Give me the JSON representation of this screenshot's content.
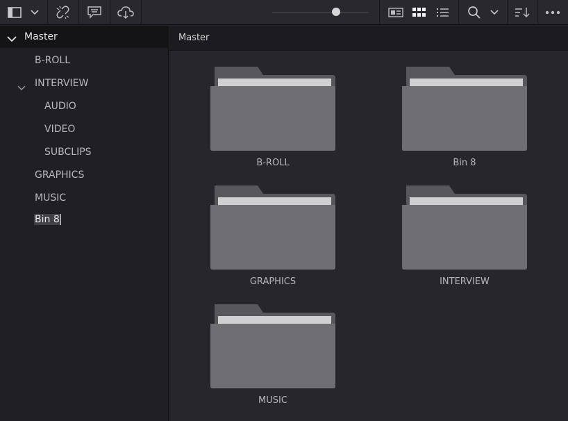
{
  "toolbar": {
    "icons": [
      "sidebar-toggle-icon",
      "chevron-down-icon",
      "unlink-icon",
      "subtitle-icon",
      "cloud-icon",
      "zoom-slider",
      "metadata-view-icon",
      "thumbnail-view-icon",
      "list-view-icon",
      "search-icon",
      "chevron-down-icon",
      "sort-icon",
      "more-icon"
    ],
    "zoom_level": 0.66
  },
  "sidebar": {
    "root": "Master",
    "items": [
      {
        "label": "B-ROLL"
      },
      {
        "label": "INTERVIEW"
      },
      {
        "label": "AUDIO"
      },
      {
        "label": "VIDEO"
      },
      {
        "label": "SUBCLIPS"
      },
      {
        "label": "GRAPHICS"
      },
      {
        "label": "MUSIC"
      },
      {
        "label": "Bin 8"
      }
    ]
  },
  "breadcrumb": {
    "label": "Master"
  },
  "folders": [
    {
      "name": "B-ROLL"
    },
    {
      "name": "Bin 8"
    },
    {
      "name": "GRAPHICS"
    },
    {
      "name": "INTERVIEW"
    },
    {
      "name": "MUSIC"
    }
  ],
  "colors": {
    "background": "#1f1f24",
    "folder": "#6f6f73",
    "folder_tab": "#58585c",
    "highlight": "#3f3f45"
  }
}
